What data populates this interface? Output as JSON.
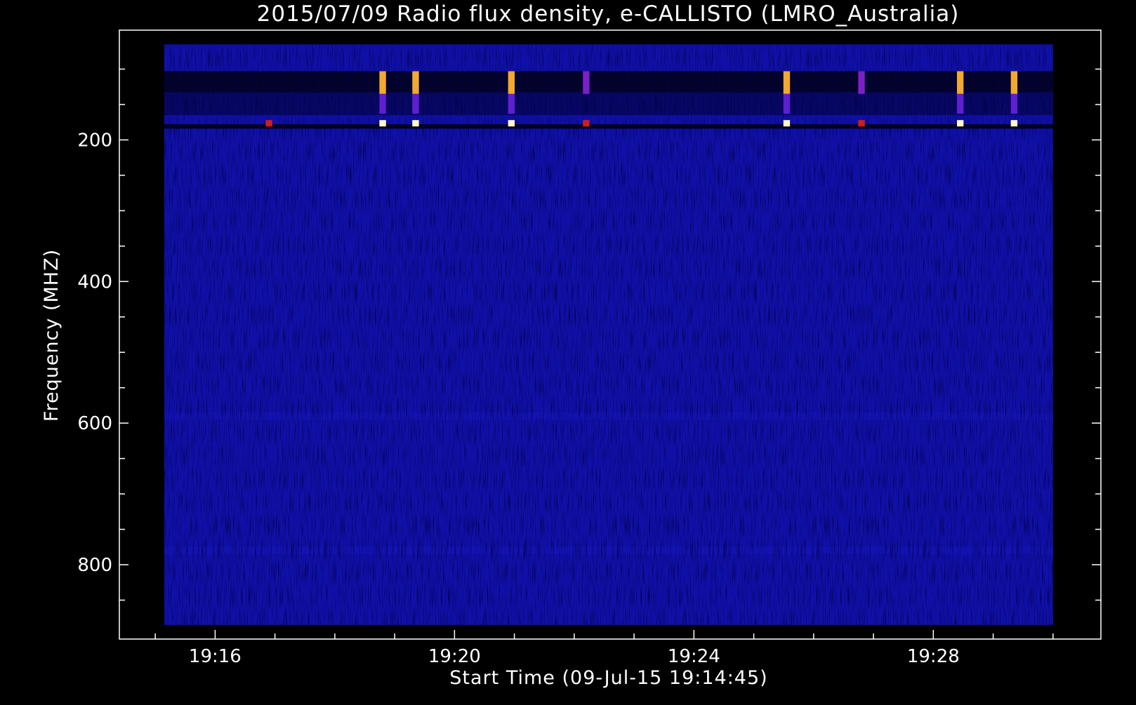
{
  "chart_data": {
    "type": "heatmap",
    "title": "2015/07/09  Radio flux density, e-CALLISTO (LMRO_Australia)",
    "xlabel": "Start Time (09-Jul-15 19:14:45)",
    "ylabel": "Frequency (MHZ)",
    "x_ticks": [
      "19:16",
      "19:20",
      "19:24",
      "19:28"
    ],
    "x_tick_minutes": [
      16,
      20,
      24,
      28
    ],
    "y_ticks": [
      "200",
      "400",
      "600",
      "800"
    ],
    "y_tick_values": [
      200,
      400,
      600,
      800
    ],
    "xlim_minutes": [
      14.4,
      30.8
    ],
    "ylim_mhz": [
      45,
      905
    ],
    "data_extent": {
      "time_start_minutes": 15.15,
      "time_end_minutes": 30.0,
      "freq_top_mhz": 65,
      "freq_bottom_mhz": 885
    },
    "y_reversed": true,
    "grid": false,
    "background_level": "low",
    "colormap": [
      "#000000",
      "#0a0a8c",
      "#1e1ee6",
      "#7a20c8",
      "#c8141e",
      "#f0a01e",
      "#fff8c8"
    ],
    "rfi_bands": [
      {
        "freq_from_mhz": 103,
        "freq_to_mhz": 133,
        "level": 0.05,
        "note": "dark band"
      },
      {
        "freq_from_mhz": 133,
        "freq_to_mhz": 165,
        "level": 0.12
      },
      {
        "freq_from_mhz": 178,
        "freq_to_mhz": 184,
        "level": 0.02,
        "note": "dark band"
      },
      {
        "freq_from_mhz": 515,
        "freq_to_mhz": 545,
        "level": 0.22
      },
      {
        "freq_from_mhz": 585,
        "freq_to_mhz": 595,
        "level": 0.24
      },
      {
        "freq_from_mhz": 775,
        "freq_to_mhz": 785,
        "level": 0.24
      }
    ],
    "bursts": [
      {
        "time_minutes": 16.9,
        "freq_from_mhz": 172,
        "freq_to_mhz": 181,
        "level": 0.68
      },
      {
        "time_minutes": 18.8,
        "freq_from_mhz": 103,
        "freq_to_mhz": 135,
        "level": 0.85
      },
      {
        "time_minutes": 18.8,
        "freq_from_mhz": 135,
        "freq_to_mhz": 163,
        "level": 0.45
      },
      {
        "time_minutes": 18.8,
        "freq_from_mhz": 172,
        "freq_to_mhz": 181,
        "level": 1.0
      },
      {
        "time_minutes": 19.35,
        "freq_from_mhz": 103,
        "freq_to_mhz": 135,
        "level": 0.85
      },
      {
        "time_minutes": 19.35,
        "freq_from_mhz": 135,
        "freq_to_mhz": 163,
        "level": 0.45
      },
      {
        "time_minutes": 19.35,
        "freq_from_mhz": 172,
        "freq_to_mhz": 181,
        "level": 1.0
      },
      {
        "time_minutes": 20.95,
        "freq_from_mhz": 103,
        "freq_to_mhz": 135,
        "level": 0.85
      },
      {
        "time_minutes": 20.95,
        "freq_from_mhz": 135,
        "freq_to_mhz": 163,
        "level": 0.45
      },
      {
        "time_minutes": 20.95,
        "freq_from_mhz": 172,
        "freq_to_mhz": 181,
        "level": 1.0
      },
      {
        "time_minutes": 22.2,
        "freq_from_mhz": 103,
        "freq_to_mhz": 135,
        "level": 0.5
      },
      {
        "time_minutes": 22.2,
        "freq_from_mhz": 172,
        "freq_to_mhz": 181,
        "level": 0.68
      },
      {
        "time_minutes": 25.55,
        "freq_from_mhz": 103,
        "freq_to_mhz": 135,
        "level": 0.85
      },
      {
        "time_minutes": 25.55,
        "freq_from_mhz": 135,
        "freq_to_mhz": 163,
        "level": 0.45
      },
      {
        "time_minutes": 25.55,
        "freq_from_mhz": 172,
        "freq_to_mhz": 181,
        "level": 1.0
      },
      {
        "time_minutes": 26.8,
        "freq_from_mhz": 103,
        "freq_to_mhz": 135,
        "level": 0.5
      },
      {
        "time_minutes": 26.8,
        "freq_from_mhz": 172,
        "freq_to_mhz": 181,
        "level": 0.68
      },
      {
        "time_minutes": 28.45,
        "freq_from_mhz": 103,
        "freq_to_mhz": 135,
        "level": 0.85
      },
      {
        "time_minutes": 28.45,
        "freq_from_mhz": 135,
        "freq_to_mhz": 163,
        "level": 0.45
      },
      {
        "time_minutes": 28.45,
        "freq_from_mhz": 172,
        "freq_to_mhz": 181,
        "level": 1.0
      },
      {
        "time_minutes": 29.35,
        "freq_from_mhz": 103,
        "freq_to_mhz": 135,
        "level": 0.85
      },
      {
        "time_minutes": 29.35,
        "freq_from_mhz": 135,
        "freq_to_mhz": 163,
        "level": 0.45
      },
      {
        "time_minutes": 29.35,
        "freq_from_mhz": 172,
        "freq_to_mhz": 181,
        "level": 1.0
      }
    ]
  }
}
